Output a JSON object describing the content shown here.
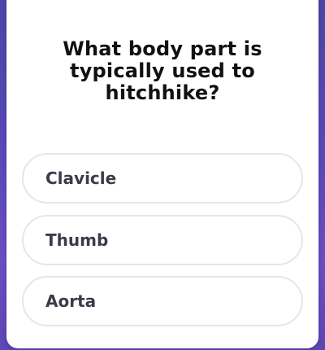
{
  "quiz": {
    "question_lines": [
      "What body part is",
      "typically used to",
      "hitchhike?"
    ],
    "answers": [
      {
        "label": "Clavicle"
      },
      {
        "label": "Thumb"
      },
      {
        "label": "Aorta"
      }
    ]
  },
  "colors": {
    "background": "#5a49b8",
    "card": "#ffffff",
    "question_text": "#111111",
    "answer_border": "#e6e6ea",
    "answer_text": "#3b3b4a"
  }
}
